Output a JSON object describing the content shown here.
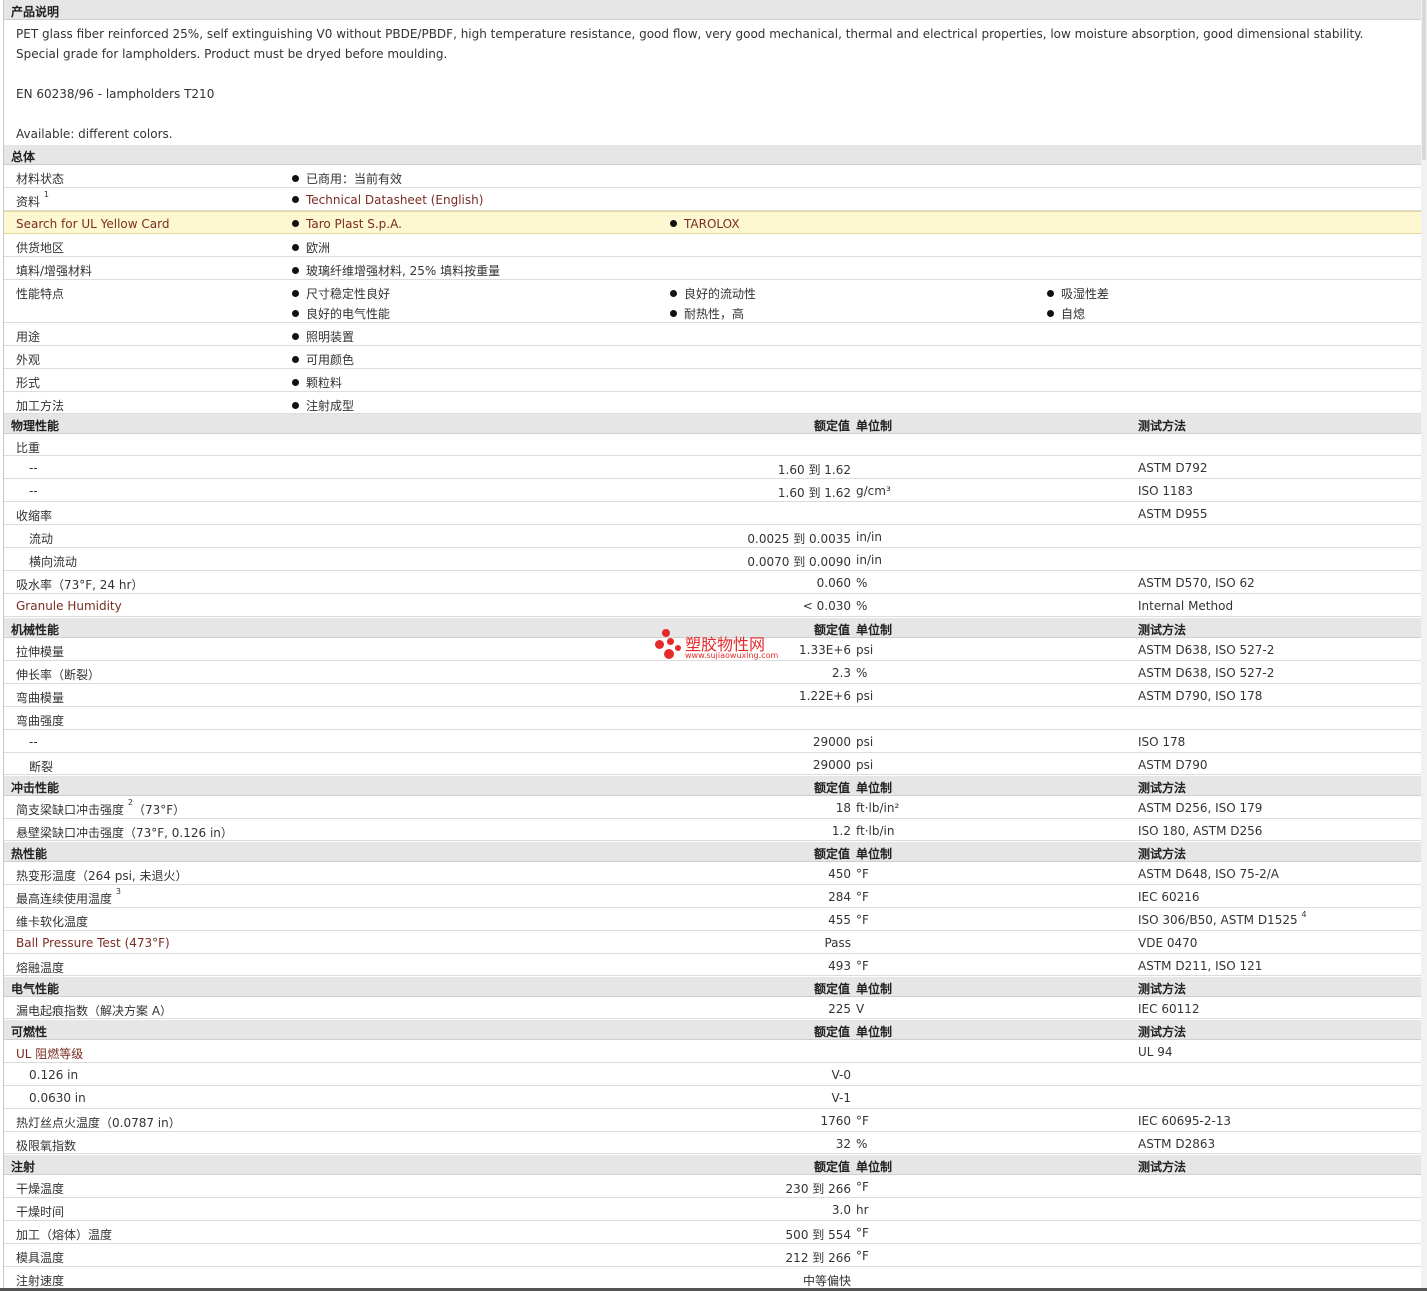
{
  "desc": {
    "title": "产品说明",
    "p1": "PET glass fiber reinforced 25%, self extinguishing V0 without PBDE/PBDF, high temperature resistance, good flow, very good mechanical, thermal and electrical properties, low moisture absorption, good dimensional stability. Special grade for lampholders. Product must be dryed before moulding.",
    "p2": "EN 60238/96 - lampholders T210",
    "p3": "Available: different colors."
  },
  "general": {
    "title": "总体",
    "status_label": "材料状态",
    "status_value": "已商用：当前有效",
    "docs_label": "资料",
    "docs_sup": "1",
    "docs_value": "Technical Datasheet (English)",
    "ul_label": "Search for UL Yellow Card",
    "ul_value1": "Taro Plast S.p.A.",
    "ul_value2": "TAROLOX",
    "region_label": "供货地区",
    "region_value": "欧洲",
    "filler_label": "填料/增强材料",
    "filler_value": "玻璃纤维增强材料, 25% 填料按重量",
    "features_label": "性能特点",
    "features": [
      "尺寸稳定性良好",
      "良好的流动性",
      "吸湿性差",
      "良好的电气性能",
      "耐热性，高",
      "自熄"
    ],
    "use_label": "用途",
    "use_value": "照明装置",
    "appearance_label": "外观",
    "appearance_value": "可用颜色",
    "form_label": "形式",
    "form_value": "颗粒料",
    "method_label": "加工方法",
    "method_value": "注射成型"
  },
  "headers": {
    "nominal": "额定值",
    "unit": "单位制",
    "test": "测试方法"
  },
  "physical": {
    "title": "物理性能",
    "rows": [
      {
        "label": "比重",
        "value": "",
        "unit": "",
        "test": ""
      },
      {
        "label": "--",
        "value": "1.60 到  1.62",
        "unit": "",
        "test": "ASTM D792"
      },
      {
        "label": "--",
        "value": "1.60 到  1.62",
        "unit": "g/cm³",
        "test": "ISO 1183"
      },
      {
        "label": "收缩率",
        "value": "",
        "unit": "",
        "test": "ASTM D955"
      },
      {
        "label": "流动",
        "value": "0.0025 到  0.0035",
        "unit": "in/in",
        "test": ""
      },
      {
        "label": "横向流动",
        "value": "0.0070 到  0.0090",
        "unit": "in/in",
        "test": ""
      },
      {
        "label": "吸水率（73°F, 24 hr）",
        "value": "0.060",
        "unit": "%",
        "test": "ASTM D570, ISO 62"
      },
      {
        "label": "Granule Humidity",
        "value": "< 0.030",
        "unit": "%",
        "test": "Internal Method"
      }
    ]
  },
  "mechanical": {
    "title": "机械性能",
    "rows": [
      {
        "label": "拉伸模量",
        "value": "1.33E+6",
        "unit": "psi",
        "test": "ASTM D638, ISO 527-2"
      },
      {
        "label": "伸长率（断裂）",
        "value": "2.3",
        "unit": "%",
        "test": "ASTM D638, ISO 527-2"
      },
      {
        "label": "弯曲模量",
        "value": "1.22E+6",
        "unit": "psi",
        "test": "ASTM D790, ISO 178"
      },
      {
        "label": "弯曲强度",
        "value": "",
        "unit": "",
        "test": ""
      },
      {
        "label": "--",
        "value": "29000",
        "unit": "psi",
        "test": "ISO 178"
      },
      {
        "label": "断裂",
        "value": "29000",
        "unit": "psi",
        "test": "ASTM D790"
      }
    ]
  },
  "impact": {
    "title": "冲击性能",
    "rows": [
      {
        "label": "简支梁缺口冲击强度",
        "sup": "2",
        "label2": "（73°F）",
        "value": "18",
        "unit": "ft·lb/in²",
        "test": "ASTM D256, ISO 179"
      },
      {
        "label": "悬壁梁缺口冲击强度（73°F, 0.126 in）",
        "value": "1.2",
        "unit": "ft·lb/in",
        "test": "ISO 180, ASTM D256"
      }
    ]
  },
  "thermal": {
    "title": "热性能",
    "rows": [
      {
        "label": "热变形温度（264 psi, 未退火）",
        "value": "450",
        "unit": "°F",
        "test": "ASTM D648, ISO 75-2/A"
      },
      {
        "label": "最高连续使用温度",
        "sup": "3",
        "value": "284",
        "unit": "°F",
        "test": "IEC 60216"
      },
      {
        "label": "维卡软化温度",
        "value": "455",
        "unit": "°F",
        "test": "ISO 306/B50, ASTM D1525",
        "test_sup": "4"
      },
      {
        "label": "Ball Pressure Test (473°F)",
        "value": "Pass",
        "unit": "",
        "test": "VDE 0470"
      },
      {
        "label": "熔融温度",
        "value": "493",
        "unit": "°F",
        "test": "ASTM D211, ISO 121"
      }
    ]
  },
  "electrical": {
    "title": "电气性能",
    "rows": [
      {
        "label": "漏电起痕指数（解决方案 A）",
        "value": "225",
        "unit": "V",
        "test": "IEC 60112"
      }
    ]
  },
  "flammability": {
    "title": "可燃性",
    "rows": [
      {
        "label": "UL 阻燃等级",
        "value": "",
        "unit": "",
        "test": "UL 94"
      },
      {
        "label": "0.126 in",
        "value": "V-0",
        "unit": "",
        "test": ""
      },
      {
        "label": "0.0630 in",
        "value": "V-1",
        "unit": "",
        "test": ""
      },
      {
        "label": "热灯丝点火温度（0.0787 in）",
        "value": "1760",
        "unit": "°F",
        "test": "IEC 60695-2-13"
      },
      {
        "label": "极限氧指数",
        "value": "32",
        "unit": "%",
        "test": "ASTM D2863"
      }
    ]
  },
  "injection": {
    "title": "注射",
    "rows": [
      {
        "label": "干燥温度",
        "value": "230 到  266",
        "unit": "°F",
        "test": ""
      },
      {
        "label": "干燥时间",
        "value": "3.0",
        "unit": "hr",
        "test": ""
      },
      {
        "label": "加工（熔体）温度",
        "value": "500 到  554",
        "unit": "°F",
        "test": ""
      },
      {
        "label": "模具温度",
        "value": "212 到  266",
        "unit": "°F",
        "test": ""
      },
      {
        "label": "注射速度",
        "value": "中等偏快",
        "unit": "",
        "test": ""
      }
    ]
  },
  "watermark": {
    "text": "塑胶物性网",
    "url": "www.sujiaowuxing.com"
  }
}
